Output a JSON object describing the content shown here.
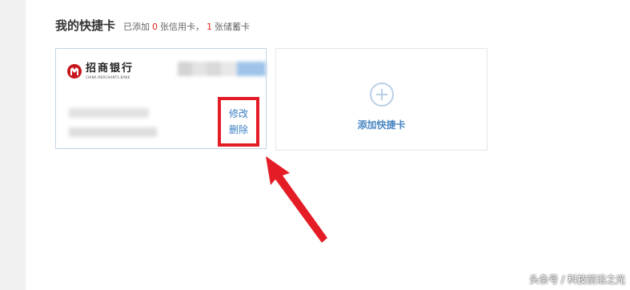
{
  "section": {
    "title": "我的快捷卡",
    "summary_prefix": "已添加",
    "credit_count": "0",
    "credit_label": "张信用卡，",
    "debit_count": "1",
    "debit_label": "张储蓄卡"
  },
  "bank_card": {
    "bank_name": "招商银行",
    "bank_name_en": "CHINA MERCHANTS BANK",
    "logo_icon": "cmb-logo-icon",
    "edit_label": "修改",
    "delete_label": "删除"
  },
  "add_card": {
    "label": "添加快捷卡",
    "icon": "plus-circle-icon"
  },
  "annotation": {
    "highlight_color": "#e41c25",
    "arrow_icon": "red-arrow-icon"
  },
  "watermark": "头条号 / 科技前沿之光",
  "colors": {
    "link": "#3a7fc4",
    "accent_red": "#e2231a",
    "card_border": "#c5d3e2"
  }
}
